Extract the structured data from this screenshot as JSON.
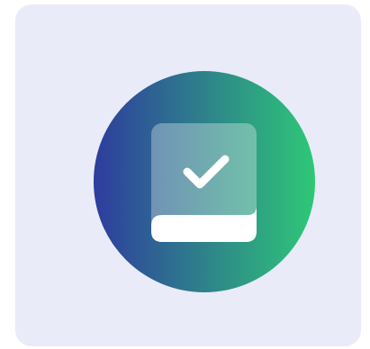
{
  "colors": {
    "card_background": "#e9ebf9",
    "gradient_start": "#2e3c9e",
    "gradient_end": "#2ec877",
    "book_cover": "#ffffff",
    "checkmark": "#ffffff"
  },
  "icon": {
    "name": "book-check-icon"
  }
}
